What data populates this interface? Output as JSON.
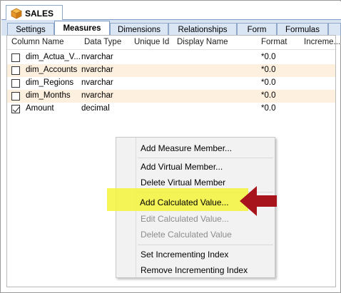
{
  "window": {
    "title": "SALES"
  },
  "tabs": [
    {
      "label": "Settings"
    },
    {
      "label": "Measures"
    },
    {
      "label": "Dimensions"
    },
    {
      "label": "Relationships"
    },
    {
      "label": "Form"
    },
    {
      "label": "Formulas"
    }
  ],
  "active_tab": "Measures",
  "table": {
    "headers": [
      "Column Name",
      "Data Type",
      "Unique Id",
      "Display Name",
      "Format",
      "Increme..."
    ],
    "rows": [
      {
        "name": "dim_Actua_V...",
        "type": "nvarchar",
        "format": "*0.0",
        "checked": false
      },
      {
        "name": "dim_Accounts",
        "type": "nvarchar",
        "format": "*0.0",
        "checked": false
      },
      {
        "name": "dim_Regions",
        "type": "nvarchar",
        "format": "*0.0",
        "checked": false
      },
      {
        "name": "dim_Months",
        "type": "nvarchar",
        "format": "*0.0",
        "checked": false
      },
      {
        "name": "Amount",
        "type": "decimal",
        "format": "*0.0",
        "checked": true
      }
    ]
  },
  "context_menu": {
    "items": [
      {
        "label": "Add Measure Member...",
        "enabled": true
      },
      {
        "label": "Add Virtual Member...",
        "enabled": true
      },
      {
        "label": "Delete Virtual Member",
        "enabled": true
      },
      {
        "label": "Add Calculated Value...",
        "enabled": true
      },
      {
        "label": "Edit Calculated Value...",
        "enabled": false
      },
      {
        "label": "Delete Calculated Value",
        "enabled": false
      },
      {
        "label": "Set Incrementing Index",
        "enabled": true
      },
      {
        "label": "Remove Incrementing Index",
        "enabled": true
      }
    ]
  },
  "colors": {
    "highlight": "#f5f53c",
    "arrow": "#a8141b",
    "tab_bg": "#dbe6f5",
    "row_alt": "#fdf0df"
  }
}
